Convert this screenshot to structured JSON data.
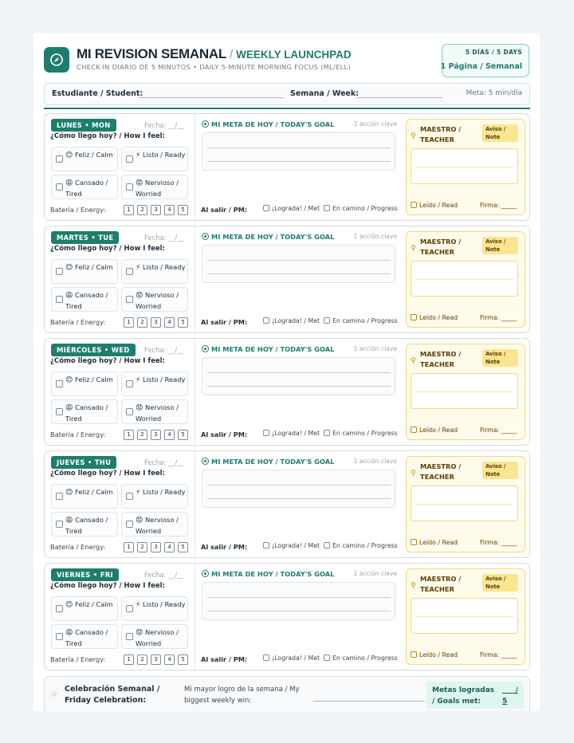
{
  "header": {
    "title": "MI REVISION SEMANAL",
    "separator": "/",
    "subtitle": "WEEKLY LAUNCHPAD",
    "tagline": "CHECK-IN DIARIO DE 5 MINUTOS • DAILY 5-MINUTE MORNING FOCUS (ML/ELL)",
    "badge_days": "5 DÍAS / 5 DAYS",
    "badge_pages": "1 Página / Semanal",
    "logo_icon": "compass-icon"
  },
  "student_bar": {
    "student_label": "Estudiante / Student:",
    "week_label": "Semana / Week:",
    "meta": "Meta: 5 min/día"
  },
  "day_labels": {
    "fecha": "Fecha: __/__",
    "feel_question": "¿Cómo llego hoy? / How I feel:",
    "moods": [
      {
        "emoji": "😊",
        "label": "Feliz / Calm"
      },
      {
        "emoji": "⚡",
        "label": "Listo / Ready"
      },
      {
        "emoji": "😩",
        "label": "Cansado / Tired"
      },
      {
        "emoji": "😟",
        "label": "Nervioso / Worried"
      }
    ],
    "energy_label": "Batería / Energy:",
    "energy_levels": [
      "1",
      "2",
      "3",
      "4",
      "5"
    ],
    "goal_header": "MI META DE HOY / TODAY'S GOAL",
    "goal_hint": "1 acción clave",
    "pm_label": "Al salir / PM:",
    "met": "¡Lograda! / Met",
    "progress": "En camino / Progress",
    "teacher": "MAESTRO / TEACHER",
    "note_tag": "Aviso / Note",
    "read": "Leído / Read",
    "signature": "Firma: _____"
  },
  "days": [
    {
      "name": "LUNES • MON"
    },
    {
      "name": "MARTES • TUE"
    },
    {
      "name": "MIÉRCOLES • WED"
    },
    {
      "name": "JUEVES • THU"
    },
    {
      "name": "VIERNES • FRI"
    }
  ],
  "footer": {
    "celebration": "Celebración Semanal / Friday Celebration:",
    "biggest_win": "Mi mayor logro de la semana / My biggest weekly win:",
    "goals_met_label": "Metas logradas / Goals met:",
    "goals_met_value": "___ / 5"
  },
  "colors": {
    "accent": "#1f7d6e",
    "teacher_bg": "#fffbea",
    "teacher_border": "#f0d982"
  }
}
